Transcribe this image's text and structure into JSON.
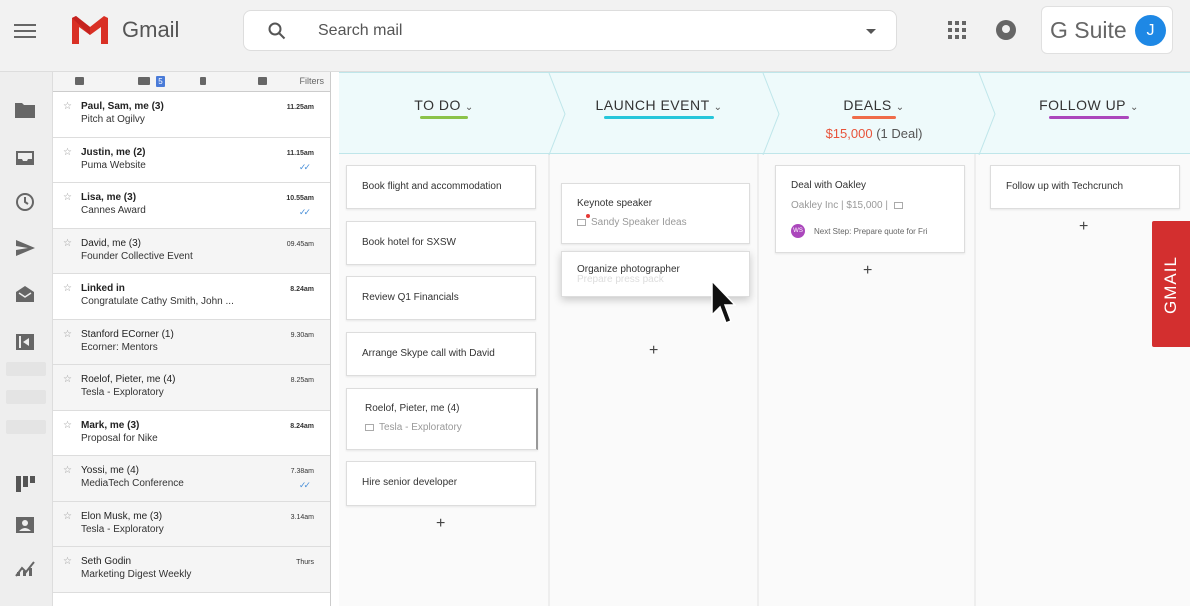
{
  "header": {
    "brand": "Gmail",
    "search_placeholder": "Search mail",
    "suite_label": "G Suite",
    "avatar_initial": "J"
  },
  "mail_header": {
    "filters_label": "Filters",
    "badge": "5"
  },
  "mails": [
    {
      "from": "Paul, Sam, me (3)",
      "subject": "Pitch at Ogilvy",
      "time": "11.25am",
      "unread": true,
      "checks": ""
    },
    {
      "from": "Justin, me (2)",
      "subject": "Puma Website",
      "time": "11.15am",
      "unread": true,
      "checks": "✓✓"
    },
    {
      "from": "Lisa, me (3)",
      "subject": "Cannes Award",
      "time": "10.55am",
      "unread": true,
      "checks": "✓✓"
    },
    {
      "from": "David, me (3)",
      "subject": "Founder Collective Event",
      "time": "09.45am",
      "unread": false,
      "checks": ""
    },
    {
      "from": "Linked in",
      "subject": "Congratulate Cathy Smith, John ...",
      "time": "8.24am",
      "unread": true,
      "checks": ""
    },
    {
      "from": "Stanford ECorner (1)",
      "subject": "Ecorner: Mentors",
      "time": "9.30am",
      "unread": false,
      "checks": ""
    },
    {
      "from": "Roelof, Pieter, me (4)",
      "subject": "Tesla - Exploratory",
      "time": "8.25am",
      "unread": false,
      "checks": ""
    },
    {
      "from": "Mark, me (3)",
      "subject": "Proposal for Nike",
      "time": "8.24am",
      "unread": true,
      "checks": ""
    },
    {
      "from": "Yossi, me (4)",
      "subject": "MediaTech Conference",
      "time": "7.38am",
      "unread": false,
      "checks": "✓✓"
    },
    {
      "from": "Elon Musk, me (3)",
      "subject": "Tesla - Exploratory",
      "time": "3.14am",
      "unread": false,
      "checks": ""
    },
    {
      "from": "Seth Godin",
      "subject": "Marketing Digest Weekly",
      "time": "Thurs",
      "unread": false,
      "checks": ""
    }
  ],
  "stages": [
    {
      "title": "TO DO",
      "color": "#8bc34a"
    },
    {
      "title": "LAUNCH EVENT",
      "color": "#26c6da"
    },
    {
      "title": "DEALS",
      "color": "#ef6c4a",
      "amount": "$15,000",
      "count": "(1 Deal)"
    },
    {
      "title": "FOLLOW UP",
      "color": "#ab47bc"
    }
  ],
  "todo_cards": [
    "Book flight and accommodation",
    "Book hotel for SXSW",
    "Review Q1 Financials",
    "Arrange Skype call with David",
    "Roelof, Pieter, me (4)",
    "Hire senior developer"
  ],
  "todo_card_sub": "Tesla - Exploratory",
  "launch_cards": {
    "keynote_title": "Keynote speaker",
    "keynote_sub": "Sandy Speaker Ideas",
    "photographer_title": "Organize photographer",
    "photographer_ghost": "Prepare press pack"
  },
  "deal_card": {
    "title": "Deal with Oakley",
    "sub": "Oakley Inc | $15,000 |",
    "ws": "WS",
    "next": "Next Step: Prepare quote for Fri"
  },
  "followup_card": "Follow up with Techcrunch",
  "plus": "+",
  "side_tab": "GMAIL"
}
